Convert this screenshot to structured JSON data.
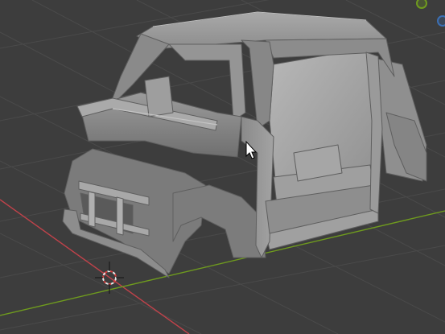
{
  "viewport": {
    "type": "3d-viewport",
    "background_color": "#3d3d3d",
    "grid_color": "#4a4a4a",
    "x_axis_color": "#c0424a",
    "y_axis_color": "#6f9b1e"
  },
  "model": {
    "object": "car-body-shell",
    "shading": "solid",
    "color": "#9a9a9a"
  },
  "cursor_3d": {
    "colors": [
      "#e8e8e8",
      "#d33b3b"
    ]
  },
  "gizmo": {
    "y_axis_color": "#6f9b1e",
    "z_axis_color": "#3b6fb4"
  },
  "mouse_cursor": {
    "icon": "arrow-pointer-icon"
  }
}
